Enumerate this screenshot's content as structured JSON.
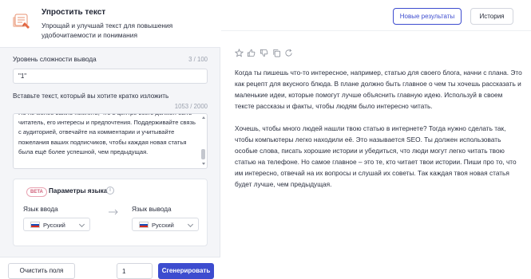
{
  "app": {
    "title": "Упростить текст",
    "description": "Упрощай и улучшай текст для повышения удобочитаемости и понимания"
  },
  "level": {
    "label": "Уровень сложности вывода",
    "counter": "3 / 100",
    "value": "\"1\""
  },
  "input_text": {
    "label": "Вставьте текст, который вы хотите кратко изложить",
    "counter": "1053 / 2000",
    "value": "Но не менее важно помнить, что в центре всего должен быть читатель, его интересы и предпочтения. Поддерживайте связь с аудиторией, отвечайте на комментарии и учитывайте пожелания ваших подписчиков, чтобы каждая новая статья была ещё более успешной, чем предыдущая."
  },
  "language": {
    "beta": "BETA",
    "title": "Параметры языка",
    "input_label": "Язык ввода",
    "output_label": "Язык вывода",
    "input_value": "Русский",
    "output_value": "Русский"
  },
  "footer": {
    "clear": "Очистить поля",
    "count": "1",
    "generate": "Сгенерировать"
  },
  "result_panel": {
    "new_results": "Новые результаты",
    "history": "История",
    "actions": [
      "star-icon",
      "thumbs-up-icon",
      "thumbs-down-icon",
      "copy-icon",
      "refresh-icon"
    ],
    "paragraphs": [
      "Когда ты пишешь что-то интересное, например, статью для своего блога, начни с плана. Это как рецепт для вкусного блюда. В плане должно быть главное о чем ты хочешь рассказать и маленькие идеи, которые помогут лучше объяснить главную идею. Используй в своем тексте рассказы и факты, чтобы людям было интересно читать.",
      "Хочешь, чтобы много людей нашли твою статью в интернете? Тогда нужно сделать так, чтобы компьютеры легко находили её. Это называется SEO. Ты должен использовать особые слова, писать хорошие истории и убедиться, что люди могут легко читать твою статью на телефоне. Но самое главное – это те, кто читает твои истории. Пиши про то, что им интересно, отвечай на их вопросы и слушай их советы. Так каждая твоя новая статья будет лучше, чем предыдущая."
    ]
  },
  "colors": {
    "accent": "#3d4ccf",
    "beta": "#d0607a",
    "panel_bg": "#f4f5f8"
  }
}
